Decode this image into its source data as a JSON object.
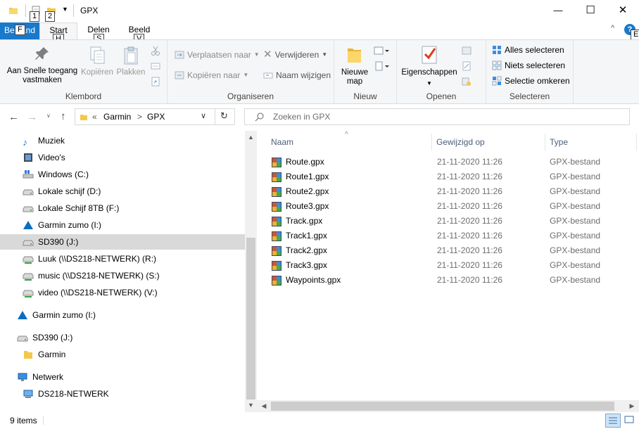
{
  "window": {
    "title": "GPX",
    "qat_keytips": [
      "1",
      "2"
    ],
    "controls": {
      "minimize": "—",
      "maximize": "☐",
      "close": "✕"
    }
  },
  "ribbon_tabs": [
    {
      "label": "Bestand",
      "keytip": "F"
    },
    {
      "label": "Start",
      "keytip": "H"
    },
    {
      "label": "Delen",
      "keytip": "S"
    },
    {
      "label": "Beeld",
      "keytip": "V"
    }
  ],
  "help_keytip": "E",
  "ribbon": {
    "klembord": {
      "label": "Klembord",
      "pin": "Aan Snelle toegang vastmaken",
      "copy": "Kopiëren",
      "paste": "Plakken"
    },
    "organiseren": {
      "label": "Organiseren",
      "move_to": "Verplaatsen naar",
      "copy_to": "Kopiëren naar",
      "delete": "Verwijderen",
      "rename": "Naam wijzigen"
    },
    "nieuw": {
      "label": "Nieuw",
      "new_folder": "Nieuwe map"
    },
    "openen": {
      "label": "Openen",
      "properties": "Eigenschappen"
    },
    "selecteren": {
      "label": "Selecteren",
      "select_all": "Alles selecteren",
      "select_none": "Niets selecteren",
      "invert": "Selectie omkeren"
    }
  },
  "address": {
    "crumbs": [
      "«",
      "Garmin",
      ">",
      "GPX"
    ],
    "search_placeholder": "Zoeken in GPX"
  },
  "navigation": [
    {
      "label": "Muziek",
      "icon": "music-icon",
      "indent": 1
    },
    {
      "label": "Video's",
      "icon": "video-icon",
      "indent": 1
    },
    {
      "label": "Windows (C:)",
      "icon": "windows-drive-icon",
      "indent": 1
    },
    {
      "label": "Lokale schijf (D:)",
      "icon": "drive-icon",
      "indent": 1
    },
    {
      "label": "Lokale Schijf 8TB (F:)",
      "icon": "drive-icon",
      "indent": 1
    },
    {
      "label": "Garmin zumo (I:)",
      "icon": "garmin-icon",
      "indent": 1
    },
    {
      "label": "SD390 (J:)",
      "icon": "drive-icon",
      "indent": 1,
      "selected": true
    },
    {
      "label": "Luuk (\\\\DS218-NETWERK) (R:)",
      "icon": "network-drive-icon",
      "indent": 1
    },
    {
      "label": "music (\\\\DS218-NETWERK) (S:)",
      "icon": "network-drive-icon",
      "indent": 1
    },
    {
      "label": "video (\\\\DS218-NETWERK) (V:)",
      "icon": "network-drive-icon",
      "indent": 1
    },
    {
      "label": "Garmin zumo (I:)",
      "icon": "garmin-icon",
      "indent": 0
    },
    {
      "label": "SD390 (J:)",
      "icon": "drive-icon",
      "indent": 0
    },
    {
      "label": "Garmin",
      "icon": "folder-icon",
      "indent": 1
    },
    {
      "label": "Netwerk",
      "icon": "network-icon",
      "indent": 0
    },
    {
      "label": "DS218-NETWERK",
      "icon": "computer-icon",
      "indent": 1
    }
  ],
  "columns": {
    "name": "Naam",
    "modified": "Gewijzigd op",
    "type": "Type"
  },
  "files": [
    {
      "name": "Route.gpx",
      "modified": "21-11-2020 11:26",
      "type": "GPX-bestand"
    },
    {
      "name": "Route1.gpx",
      "modified": "21-11-2020 11:26",
      "type": "GPX-bestand"
    },
    {
      "name": "Route2.gpx",
      "modified": "21-11-2020 11:26",
      "type": "GPX-bestand"
    },
    {
      "name": "Route3.gpx",
      "modified": "21-11-2020 11:26",
      "type": "GPX-bestand"
    },
    {
      "name": "Track.gpx",
      "modified": "21-11-2020 11:26",
      "type": "GPX-bestand"
    },
    {
      "name": "Track1.gpx",
      "modified": "21-11-2020 11:26",
      "type": "GPX-bestand"
    },
    {
      "name": "Track2.gpx",
      "modified": "21-11-2020 11:26",
      "type": "GPX-bestand"
    },
    {
      "name": "Track3.gpx",
      "modified": "21-11-2020 11:26",
      "type": "GPX-bestand"
    },
    {
      "name": "Waypoints.gpx",
      "modified": "21-11-2020 11:26",
      "type": "GPX-bestand"
    }
  ],
  "status": {
    "count": "9 items"
  },
  "colors": {
    "accent": "#0078d7",
    "selection": "#d9d9d9",
    "ribbon_bg": "#f5f6f7",
    "header_text": "#4c607a"
  }
}
